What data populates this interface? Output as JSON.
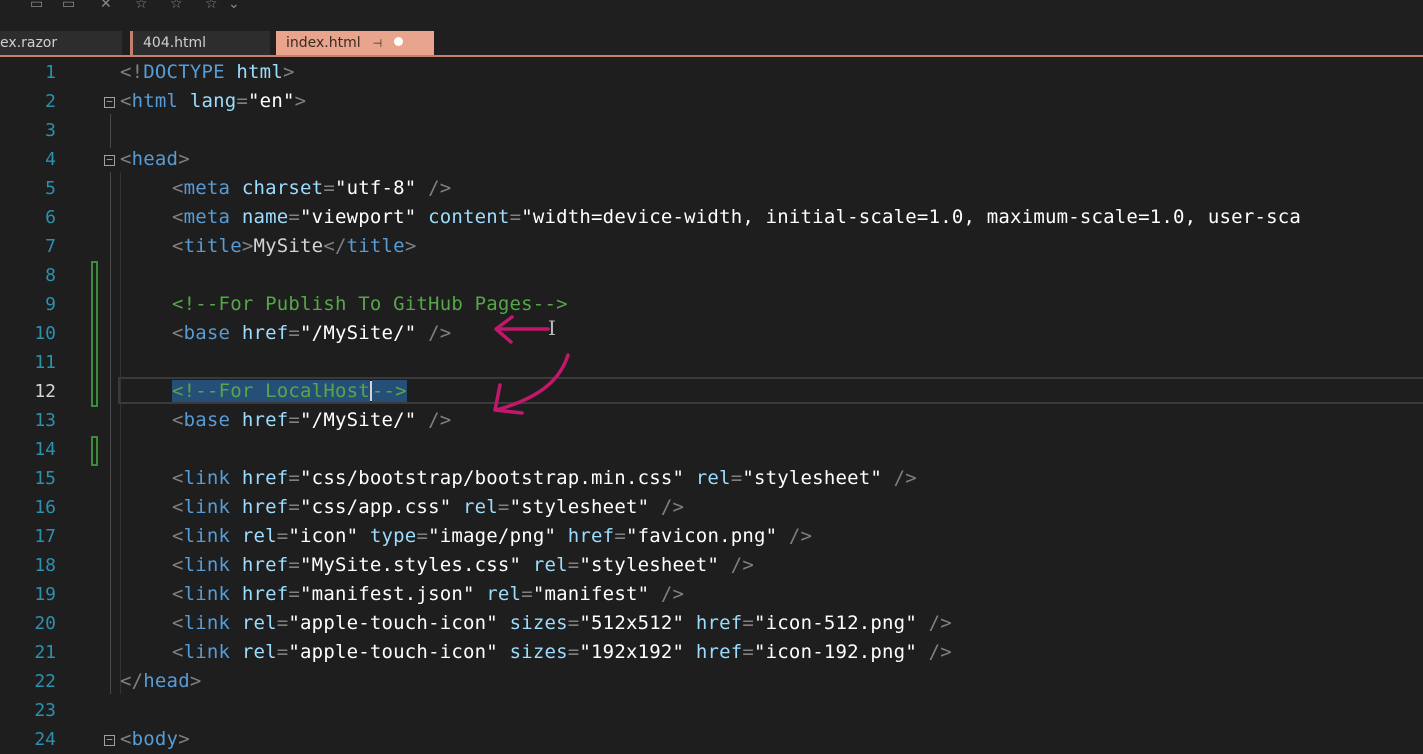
{
  "tabs": [
    {
      "label": "ex.razor"
    },
    {
      "label": "404.html"
    },
    {
      "label": "index.html",
      "pin": "⊣",
      "active": true
    }
  ],
  "toolbar": {
    "icons": [
      "save-icon",
      "save-all-icon",
      "pin-icon",
      "star-icon",
      "star-icon",
      "star-icon",
      "chevron-down-icon"
    ]
  },
  "current_line": 12,
  "line_numbers": [
    "1",
    "2",
    "3",
    "4",
    "5",
    "6",
    "7",
    "8",
    "9",
    "10",
    "11",
    "12",
    "13",
    "14",
    "15",
    "16",
    "17",
    "18",
    "19",
    "20",
    "21",
    "22",
    "23",
    "24"
  ],
  "code": {
    "l1": {
      "open": "<!",
      "doctype": "DOCTYPE",
      "sp": " ",
      "html": "html",
      "close": ">"
    },
    "l2": {
      "open": "<",
      "tag": "html",
      "attr": "lang",
      "eq": "=",
      "val": "\"en\"",
      "close": ">"
    },
    "l4": {
      "open": "<",
      "tag": "head",
      "close": ">"
    },
    "l5": {
      "open": "<",
      "tag": "meta",
      "attr": "charset",
      "eq": "=",
      "val": "\"utf-8\"",
      "close": " />"
    },
    "l6": {
      "open": "<",
      "tag": "meta",
      "attr1": "name",
      "eq1": "=",
      "val1": "\"viewport\"",
      "attr2": "content",
      "eq2": "=",
      "val2": "\"width=device-width, initial-scale=1.0, maximum-scale=1.0, user-sca"
    },
    "l7": {
      "open": "<",
      "tag": "title",
      "close1": ">",
      "text": "MySite",
      "open2": "</",
      "tag2": "title",
      "close2": ">"
    },
    "l9": {
      "comment": "<!--For Publish To GitHub Pages-->"
    },
    "l10": {
      "open": "<",
      "tag": "base",
      "attr": "href",
      "eq": "=",
      "val": "\"/MySite/\"",
      "close": " />"
    },
    "l12": {
      "c1": "<!--",
      "c2": "For LocalHost",
      "c3": "-->"
    },
    "l13": {
      "open": "<",
      "tag": "base",
      "attr": "href",
      "eq": "=",
      "val": "\"/MySite/\"",
      "close": " />"
    },
    "l15": {
      "open": "<",
      "tag": "link",
      "a1": "href",
      "v1": "\"css/bootstrap/bootstrap.min.css\"",
      "a2": "rel",
      "v2": "\"stylesheet\"",
      "close": " />"
    },
    "l16": {
      "open": "<",
      "tag": "link",
      "a1": "href",
      "v1": "\"css/app.css\"",
      "a2": "rel",
      "v2": "\"stylesheet\"",
      "close": " />"
    },
    "l17": {
      "open": "<",
      "tag": "link",
      "a1": "rel",
      "v1": "\"icon\"",
      "a2": "type",
      "v2": "\"image/png\"",
      "a3": "href",
      "v3": "\"favicon.png\"",
      "close": " />"
    },
    "l18": {
      "open": "<",
      "tag": "link",
      "a1": "href",
      "v1": "\"MySite.styles.css\"",
      "a2": "rel",
      "v2": "\"stylesheet\"",
      "close": " />"
    },
    "l19": {
      "open": "<",
      "tag": "link",
      "a1": "href",
      "v1": "\"manifest.json\"",
      "a2": "rel",
      "v2": "\"manifest\"",
      "close": " />"
    },
    "l20": {
      "open": "<",
      "tag": "link",
      "a1": "rel",
      "v1": "\"apple-touch-icon\"",
      "a2": "sizes",
      "v2": "\"512x512\"",
      "a3": "href",
      "v3": "\"icon-512.png\"",
      "close": " />"
    },
    "l21": {
      "open": "<",
      "tag": "link",
      "a1": "rel",
      "v1": "\"apple-touch-icon\"",
      "a2": "sizes",
      "v2": "\"192x192\"",
      "a3": "href",
      "v3": "\"icon-192.png\"",
      "close": " />"
    },
    "l22": {
      "open": "</",
      "tag": "head",
      "close": ">"
    },
    "l24": {
      "open": "<",
      "tag": "body",
      "close": ">"
    }
  },
  "colors": {
    "tag": "#569cd6",
    "attribute": "#9cdcfe",
    "value": "#ffffff",
    "comment": "#57a64a",
    "punct": "#808080",
    "selection": "#264f78",
    "annotation": "#c2186b",
    "active_tab": "#e8a48c"
  }
}
